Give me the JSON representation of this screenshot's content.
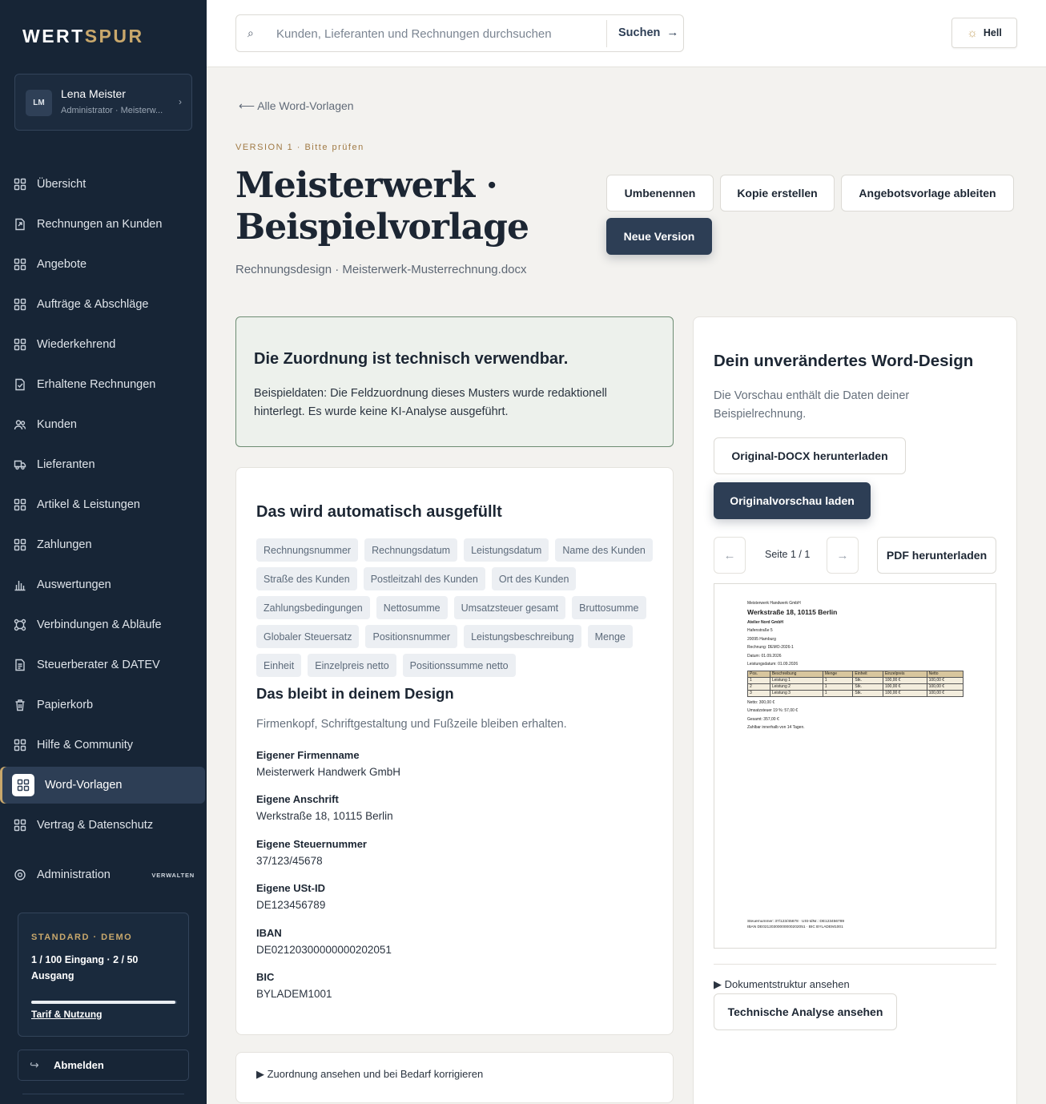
{
  "sidebar": {
    "logo_part1": "WERT",
    "logo_part2": "SPUR",
    "user": {
      "initials": "LM",
      "name": "Lena Meister",
      "role": "Administrator · Meisterw..."
    },
    "items": [
      {
        "label": "Übersicht",
        "icon": "grid-icon"
      },
      {
        "label": "Rechnungen an Kunden",
        "icon": "invoice-out-icon"
      },
      {
        "label": "Angebote",
        "icon": "grid-icon"
      },
      {
        "label": "Aufträge & Abschläge",
        "icon": "grid-icon"
      },
      {
        "label": "Wiederkehrend",
        "icon": "grid-icon"
      },
      {
        "label": "Erhaltene Rechnungen",
        "icon": "invoice-in-icon"
      },
      {
        "label": "Kunden",
        "icon": "users-icon"
      },
      {
        "label": "Lieferanten",
        "icon": "truck-icon"
      },
      {
        "label": "Artikel & Leistungen",
        "icon": "grid-icon"
      },
      {
        "label": "Zahlungen",
        "icon": "grid-icon"
      },
      {
        "label": "Auswertungen",
        "icon": "bar-chart-icon"
      },
      {
        "label": "Verbindungen & Abläufe",
        "icon": "workflow-icon"
      },
      {
        "label": "Steuerberater & DATEV",
        "icon": "document-icon"
      },
      {
        "label": "Papierkorb",
        "icon": "trash-icon"
      },
      {
        "label": "Hilfe & Community",
        "icon": "grid-icon"
      },
      {
        "label": "Word-Vorlagen",
        "icon": "grid-icon",
        "active": true
      },
      {
        "label": "Vertrag & Datenschutz",
        "icon": "grid-icon"
      }
    ],
    "admin": {
      "label": "Administration",
      "badge": "VERWALTEN",
      "icon": "gear-icon"
    },
    "plan": {
      "title": "STANDARD · DEMO",
      "usage": "1 / 100 Eingang · 2 / 50 Ausgang",
      "usage_fraction": 0.99,
      "link": "Tarif & Nutzung"
    },
    "logout": "Abmelden"
  },
  "topbar": {
    "search_placeholder": "Kunden, Lieferanten und Rechnungen durchsuchen",
    "search_button": "Suchen",
    "theme_label": "Hell"
  },
  "header": {
    "back_link": "Alle Word-Vorlagen",
    "version": "VERSION 1 · Bitte prüfen",
    "title": "Meisterwerk · Beispielvorlage",
    "subtitle": "Rechnungsdesign · Meisterwerk-Musterrechnung.docx",
    "actions": {
      "rename": "Umbenennen",
      "copy": "Kopie erstellen",
      "derive": "Angebotsvorlage ableiten",
      "new_version": "Neue Version"
    }
  },
  "notice": {
    "title": "Die Zuordnung ist technisch verwendbar.",
    "text": "Beispieldaten: Die Feldzuordnung dieses Musters wurde redaktionell hinterlegt. Es wurde keine KI-Analyse ausgeführt."
  },
  "fields": {
    "title": "Das wird automatisch ausgefüllt",
    "chips": [
      "Rechnungsnummer",
      "Rechnungsdatum",
      "Leistungsdatum",
      "Name des Kunden",
      "Straße des Kunden",
      "Postleitzahl des Kunden",
      "Ort des Kunden",
      "Zahlungsbedingungen",
      "Nettosumme",
      "Umsatzsteuer gesamt",
      "Bruttosumme",
      "Globaler Steuersatz",
      "Positionsnummer",
      "Leistungsbeschreibung",
      "Menge",
      "Einheit",
      "Einzelpreis netto",
      "Positionssumme netto"
    ],
    "design_title": "Das bleibt in deinem Design",
    "design_sub": "Firmenkopf, Schriftgestaltung und Fußzeile bleiben erhalten.",
    "props": [
      {
        "label": "Eigener Firmenname",
        "value": "Meisterwerk Handwerk GmbH"
      },
      {
        "label": "Eigene Anschrift",
        "value": "Werkstraße 18, 10115 Berlin"
      },
      {
        "label": "Eigene Steuernummer",
        "value": "37/123/45678"
      },
      {
        "label": "Eigene USt-ID",
        "value": "DE123456789"
      },
      {
        "label": "IBAN",
        "value": "DE02120300000000202051"
      },
      {
        "label": "BIC",
        "value": "BYLADEM1001"
      }
    ],
    "mapping_toggle": "Zuordnung ansehen und bei Bedarf korrigieren"
  },
  "preview": {
    "title": "Dein unverändertes Word-Design",
    "sub": "Die Vorschau enthält die Daten deiner Beispielrechnung.",
    "download_docx": "Original-DOCX herunterladen",
    "load_preview": "Originalvorschau laden",
    "page_indicator": "Seite 1 / 1",
    "download_pdf": "PDF herunterladen",
    "doc": {
      "company_small": "Meisterwerk Handwerk GmbH",
      "company_address": "Werkstraße 18, 10115 Berlin",
      "recipient": "Atelier Nord GmbH",
      "street": "Hafenstraße 5",
      "city": "20095 Hamburg",
      "invoice_no": "Rechnung: DEMO-2026-1",
      "date": "Datum: 01.09.2026",
      "service_date": "Leistungsdatum: 01.09.2026",
      "table_headers": [
        "Pos.",
        "Beschreibung",
        "Menge",
        "Einheit",
        "Einzelpreis",
        "Netto"
      ],
      "rows": [
        [
          "1",
          "Leistung 1",
          "1",
          "Stk.",
          "100,00 €",
          "100,00 €"
        ],
        [
          "2",
          "Leistung 2",
          "1",
          "Stk.",
          "100,00 €",
          "100,00 €"
        ],
        [
          "3",
          "Leistung 3",
          "1",
          "Stk.",
          "100,00 €",
          "100,00 €"
        ]
      ],
      "net": "Netto: 300,00 €",
      "vat": "Umsatzsteuer 19 %: 57,00 €",
      "total": "Gesamt: 357,00 €",
      "terms": "Zahlbar innerhalb von 14 Tagen.",
      "footer1": "Steuernummer: 37/123/45678 · USt-IdNr.: DE123456789",
      "footer2": "IBAN DE02120300000000202051 · BIC BYLADEM1001"
    },
    "structure_toggle": "Dokumentstruktur ansehen",
    "technical": "Technische Analyse ansehen"
  }
}
